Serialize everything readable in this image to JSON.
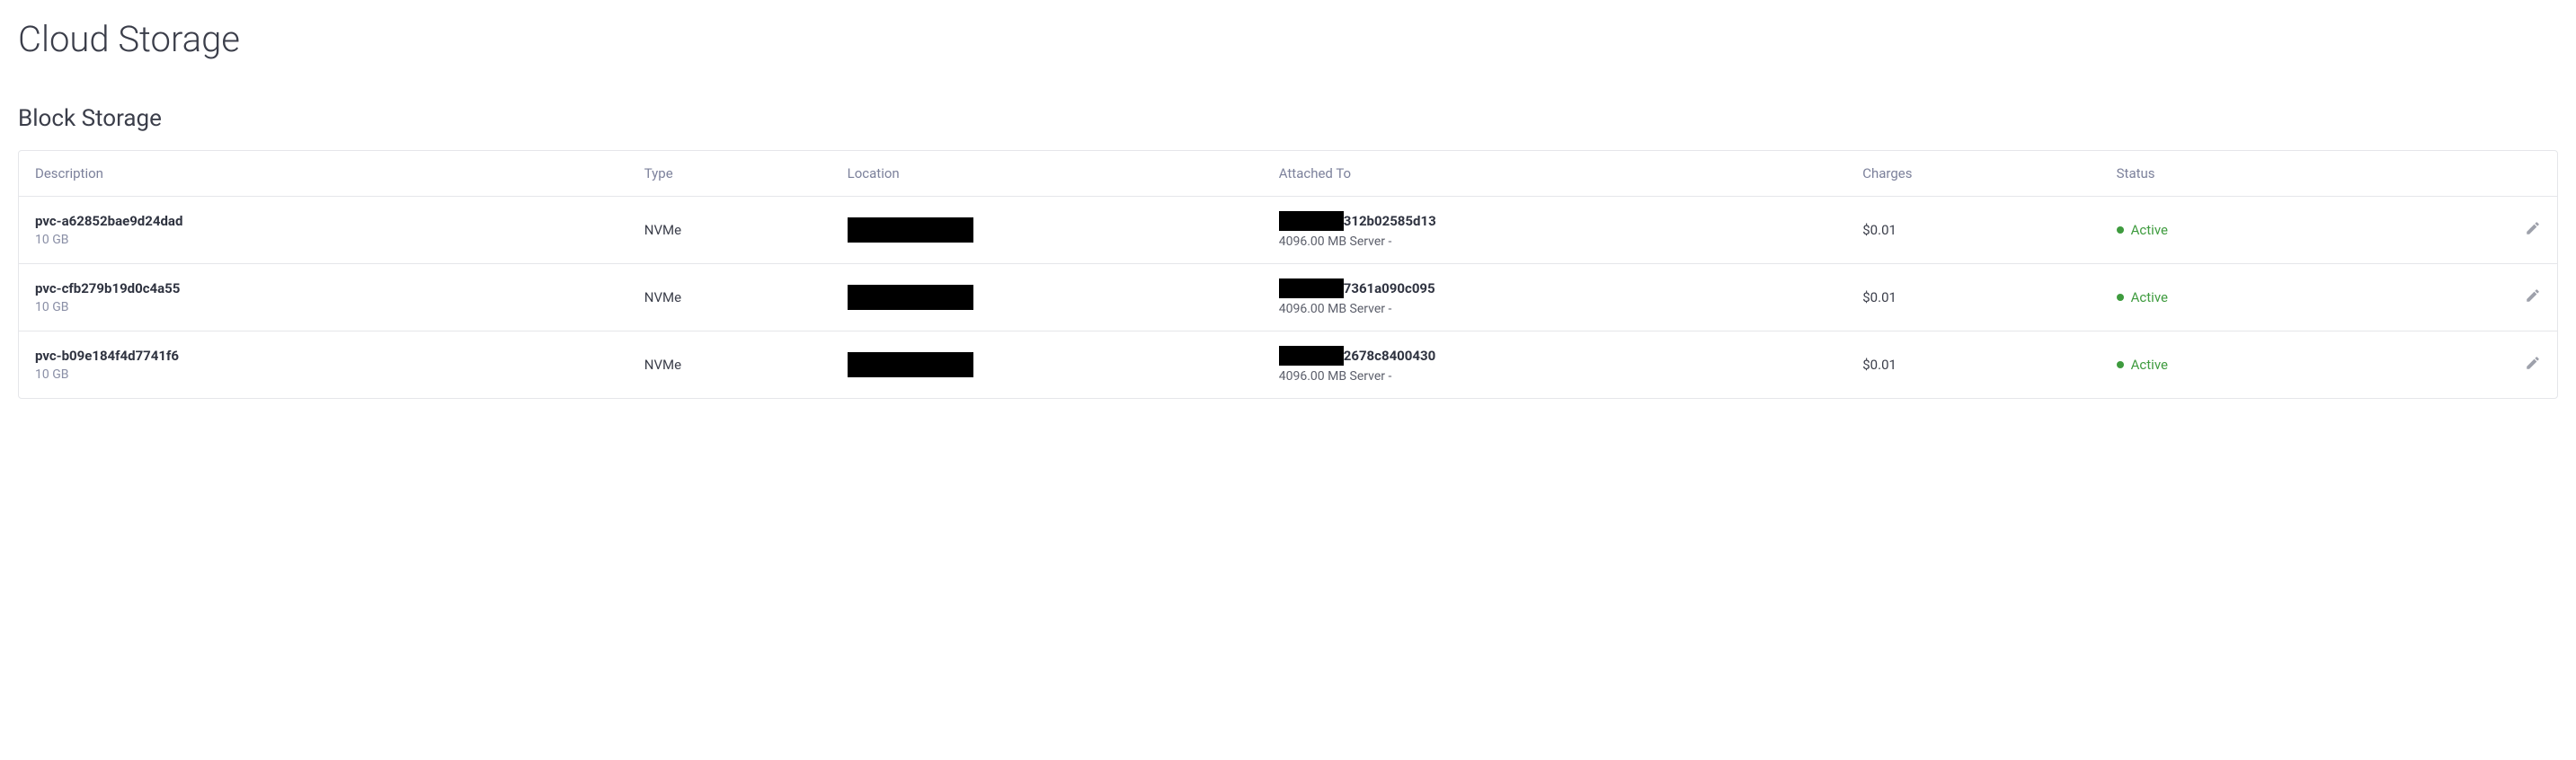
{
  "page": {
    "title": "Cloud Storage",
    "section_title": "Block Storage"
  },
  "table": {
    "headers": {
      "description": "Description",
      "type": "Type",
      "location": "Location",
      "attached_to": "Attached To",
      "charges": "Charges",
      "status": "Status"
    },
    "rows": [
      {
        "name": "pvc-a62852bae9d24dad",
        "size": "10 GB",
        "type": "NVMe",
        "attached_id_suffix": "312b02585d13",
        "server_info": "4096.00 MB Server -",
        "charges": "$0.01",
        "status": "Active"
      },
      {
        "name": "pvc-cfb279b19d0c4a55",
        "size": "10 GB",
        "type": "NVMe",
        "attached_id_suffix": "7361a090c095",
        "server_info": "4096.00 MB Server -",
        "charges": "$0.01",
        "status": "Active"
      },
      {
        "name": "pvc-b09e184f4d7741f6",
        "size": "10 GB",
        "type": "NVMe",
        "attached_id_suffix": "2678c8400430",
        "server_info": "4096.00 MB Server -",
        "charges": "$0.01",
        "status": "Active"
      }
    ]
  }
}
